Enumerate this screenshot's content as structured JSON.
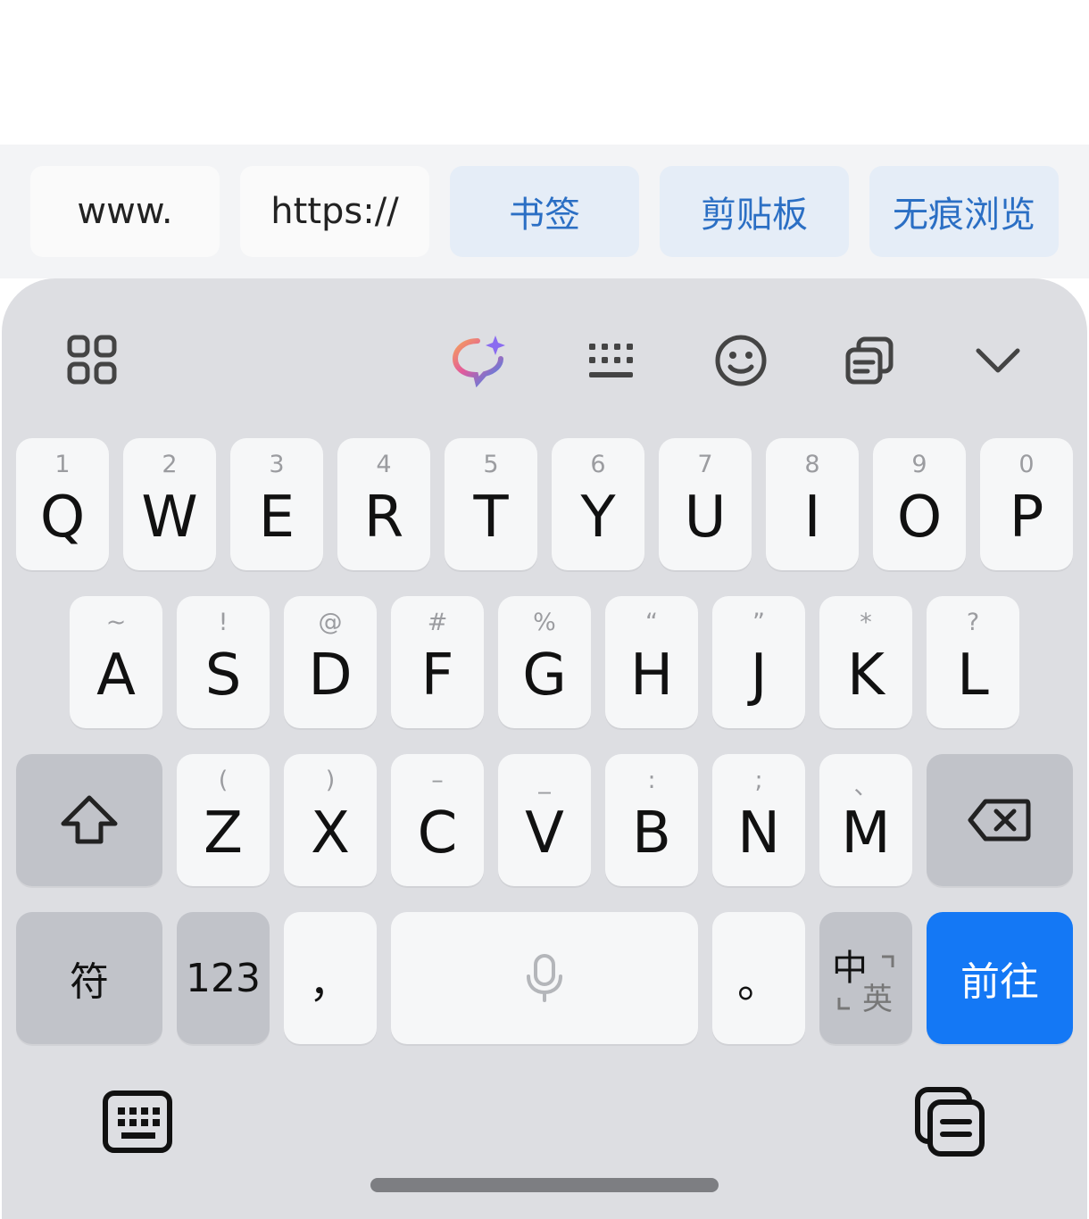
{
  "quick_bar": {
    "chips": [
      "www.",
      "https://",
      "书签",
      "剪贴板",
      "无痕浏览"
    ]
  },
  "toolbar": {
    "icons": [
      "apps-grid-icon",
      "ai-assistant-icon",
      "keyboard-layout-icon",
      "emoji-icon",
      "clipboard-icon",
      "collapse-keyboard-icon"
    ]
  },
  "keys": {
    "row1": [
      {
        "main": "Q",
        "hint": "1"
      },
      {
        "main": "W",
        "hint": "2"
      },
      {
        "main": "E",
        "hint": "3"
      },
      {
        "main": "R",
        "hint": "4"
      },
      {
        "main": "T",
        "hint": "5"
      },
      {
        "main": "Y",
        "hint": "6"
      },
      {
        "main": "U",
        "hint": "7"
      },
      {
        "main": "I",
        "hint": "8"
      },
      {
        "main": "O",
        "hint": "9"
      },
      {
        "main": "P",
        "hint": "0"
      }
    ],
    "row2": [
      {
        "main": "A",
        "hint": "~"
      },
      {
        "main": "S",
        "hint": "!"
      },
      {
        "main": "D",
        "hint": "@"
      },
      {
        "main": "F",
        "hint": "#"
      },
      {
        "main": "G",
        "hint": "%"
      },
      {
        "main": "H",
        "hint": "“"
      },
      {
        "main": "J",
        "hint": "”"
      },
      {
        "main": "K",
        "hint": "*"
      },
      {
        "main": "L",
        "hint": "?"
      }
    ],
    "row3": [
      {
        "main": "Z",
        "hint": "("
      },
      {
        "main": "X",
        "hint": ")"
      },
      {
        "main": "C",
        "hint": "–"
      },
      {
        "main": "V",
        "hint": "_"
      },
      {
        "main": "B",
        "hint": ":"
      },
      {
        "main": "N",
        "hint": ";"
      },
      {
        "main": "M",
        "hint": "、"
      }
    ],
    "symbols": "符",
    "numbers": "123",
    "comma": "，",
    "period": "。",
    "lang_zh": "中",
    "lang_en": "英",
    "go": "前往"
  },
  "colors": {
    "accent": "#1478f5",
    "chip_text": "#2b6fc4",
    "keyboard_bg": "#dddee2"
  }
}
